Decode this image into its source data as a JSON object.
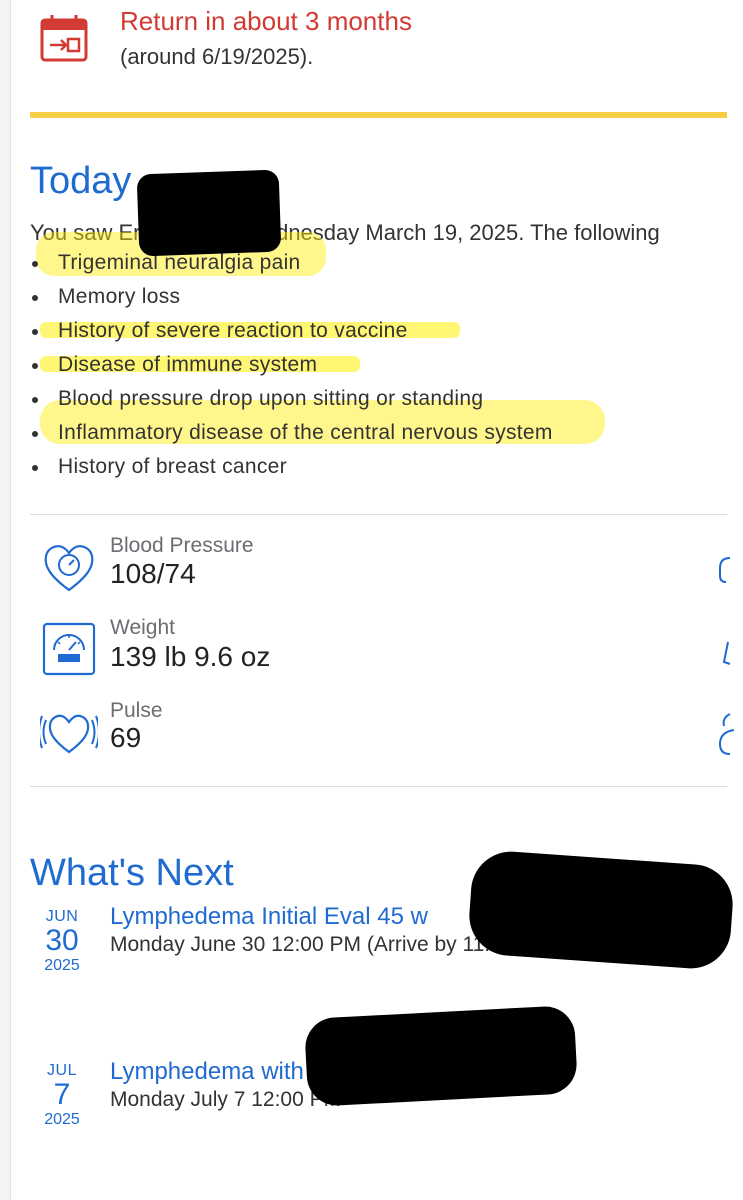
{
  "return_visit": {
    "title": "Return in about 3 months",
    "subtitle": "(around 6/19/2025)."
  },
  "todays_visit": {
    "heading": "Today",
    "saw_prefix": "You saw Er",
    "saw_suffix": "Wednesday March 19, 2025. The following",
    "diagnoses": [
      "Trigeminal neuralgia pain",
      "Memory loss",
      "History of severe reaction to vaccine",
      "Disease of immune system",
      "Blood pressure drop upon sitting or standing",
      "Inflammatory disease of the central nervous system",
      "History of breast cancer"
    ]
  },
  "vitals": [
    {
      "label": "Blood Pressure",
      "value": "108/74",
      "icon": "heart-gauge-icon"
    },
    {
      "label": "Weight",
      "value": "139 lb 9.6 oz",
      "icon": "scale-icon"
    },
    {
      "label": "Pulse",
      "value": "69",
      "icon": "pulse-heart-icon"
    }
  ],
  "whats_next": {
    "heading": "What's Next",
    "appointments": [
      {
        "month": "JUN",
        "day": "30",
        "year": "2025",
        "title": "Lymphedema Initial Eval 45 w",
        "time": "Monday June 30 12:00 PM (Arrive by 11:45 AM)"
      },
      {
        "month": "JUL",
        "day": "7",
        "year": "2025",
        "title": "Lymphedema with K",
        "time": "Monday July 7 12:00 PM"
      }
    ]
  },
  "colors": {
    "accent_blue": "#1f6bd1",
    "alert_red": "#d23a33",
    "rule_yellow": "#f7cf47",
    "highlighter": "#ffee00"
  }
}
